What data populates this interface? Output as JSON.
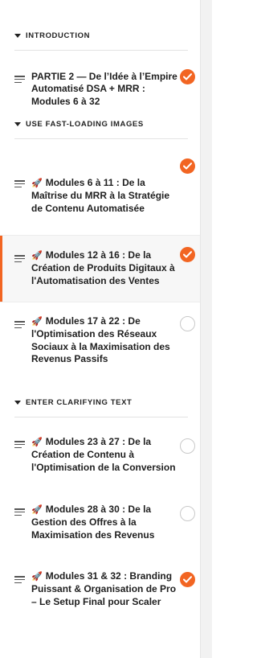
{
  "accent_color": "#f26522",
  "sections": [
    {
      "title": "INTRODUCTION"
    },
    {
      "title": "USE FAST-LOADING IMAGES"
    },
    {
      "title": "ENTER CLARIFYING TEXT"
    }
  ],
  "lessons": [
    {
      "prefix": "",
      "title": "PARTIE 2 — De l’Idée à l’Empire Automatisé DSA + MRR : Modules 6 à 32",
      "completed": true
    },
    {
      "prefix": "🚀",
      "title": "Modules 6 à 11 : De la Maîtrise du MRR à la Stratégie de Contenu Automatisée",
      "completed": true
    },
    {
      "prefix": "🚀",
      "title": "Modules 12 à 16 : De la Création de Produits Digitaux à l'Automatisation des Ventes",
      "completed": true,
      "active": true
    },
    {
      "prefix": "🚀",
      "title": "Modules 17 à 22 : De l'Optimisation des Réseaux Sociaux à la Maximisation des Revenus Passifs",
      "completed": false
    },
    {
      "prefix": "🚀",
      "title": "Modules 23 à 27 : De la Création de Contenu à l'Optimisation de la Conversion",
      "completed": false
    },
    {
      "prefix": "🚀",
      "title": "Modules 28 à 30 : De la Gestion des Offres à la Maximisation des Revenus",
      "completed": false
    },
    {
      "prefix": "🚀",
      "title": "Modules 31 & 32 : Branding Puissant & Organisation de Pro – Le Setup Final pour Scaler",
      "completed": true
    }
  ]
}
